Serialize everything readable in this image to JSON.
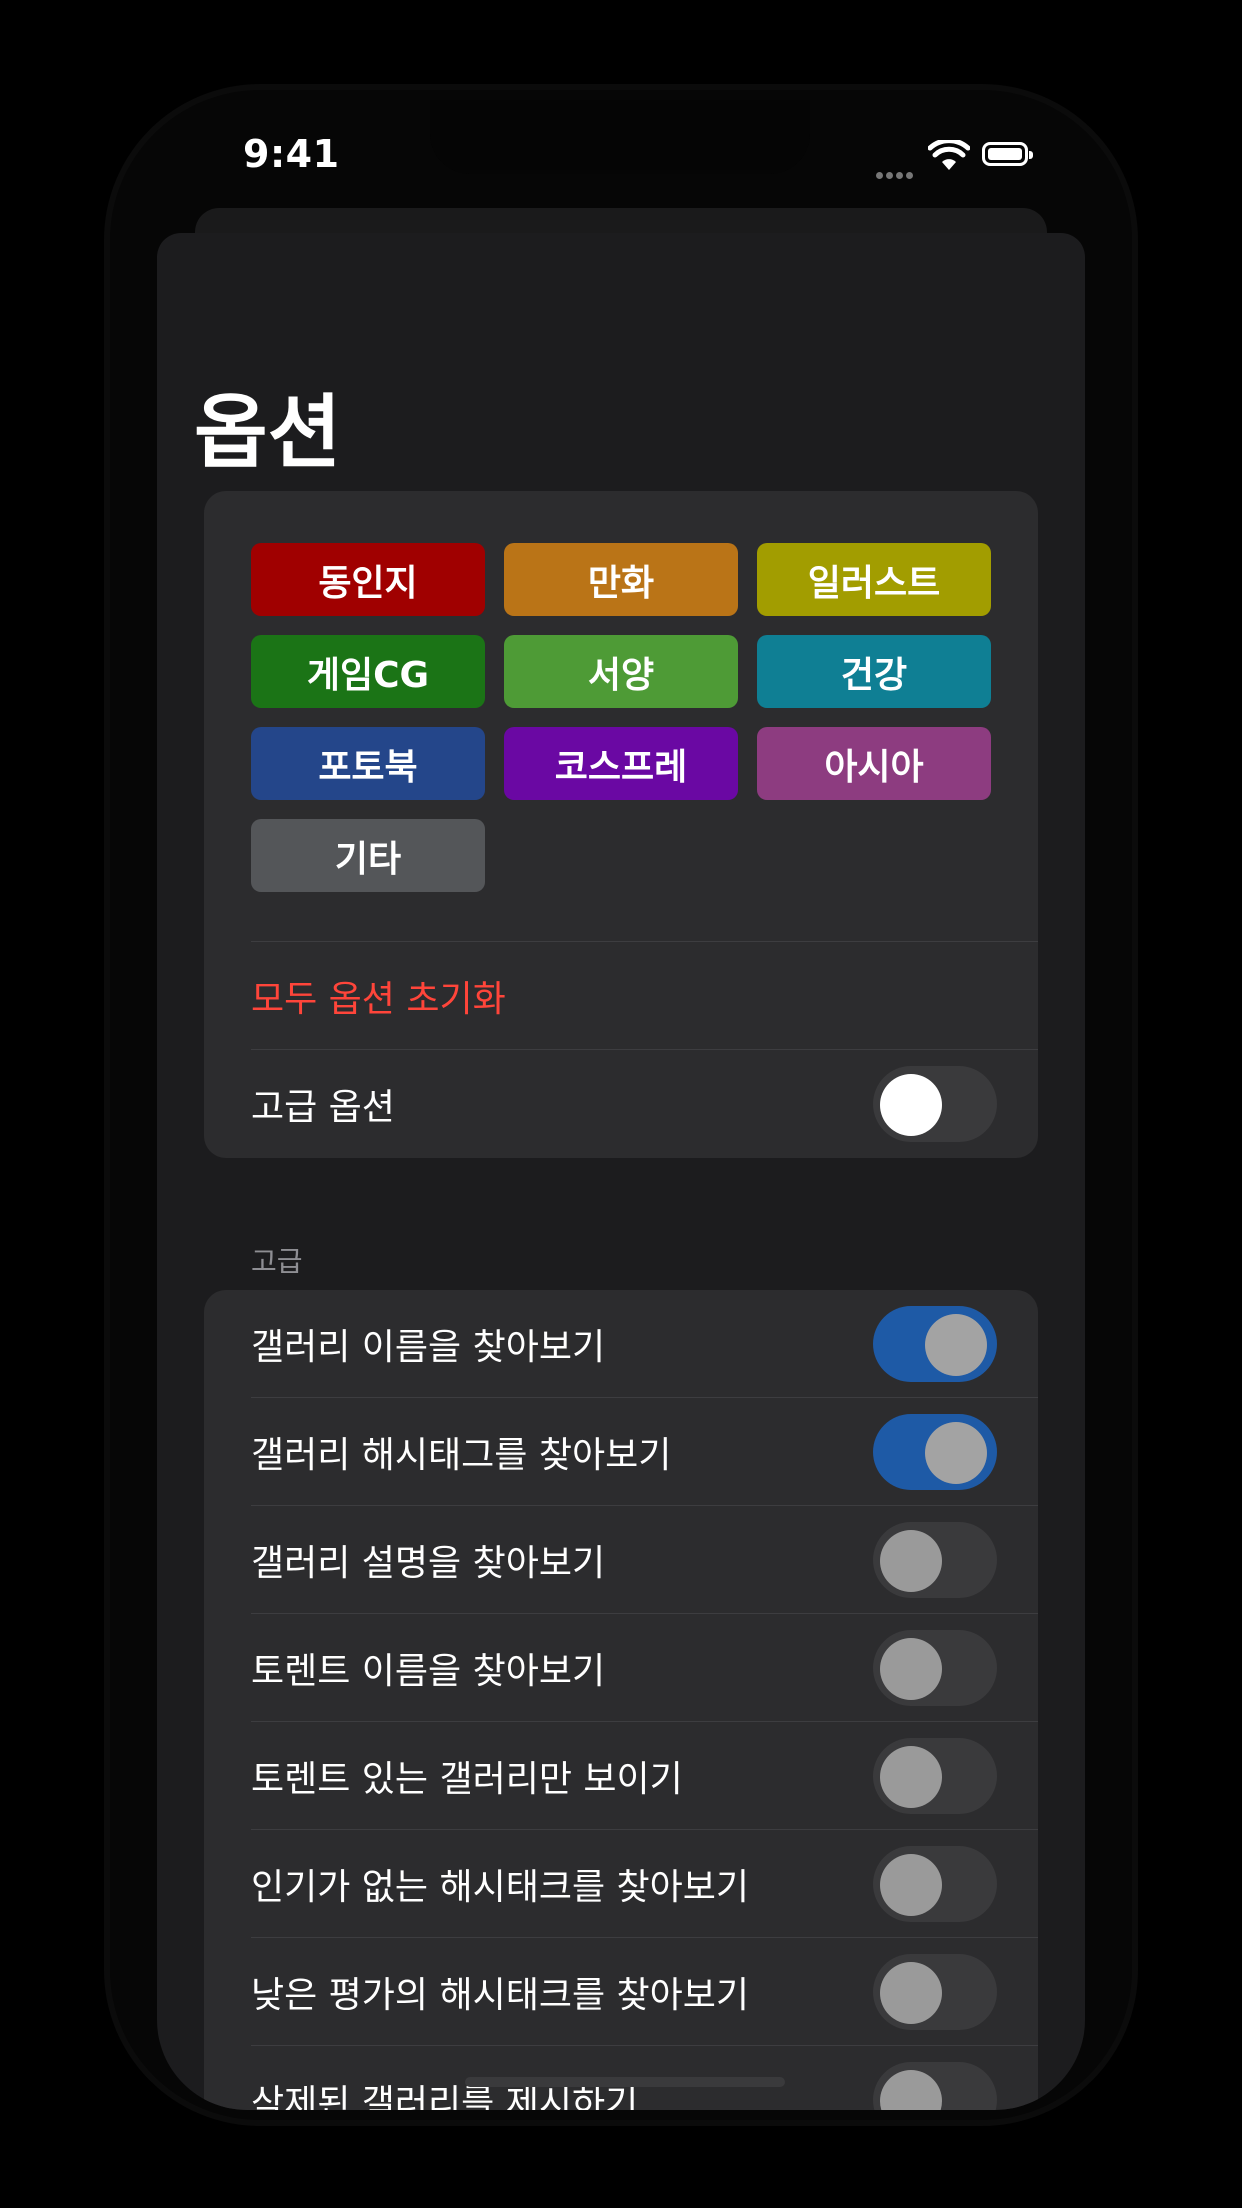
{
  "status_bar": {
    "time": "9:41"
  },
  "page": {
    "title": "옵션"
  },
  "categories": [
    {
      "label": "동인지",
      "color": "#a00000"
    },
    {
      "label": "만화",
      "color": "#ba7417"
    },
    {
      "label": "일러스트",
      "color": "#a29d00"
    },
    {
      "label": "게임CG",
      "color": "#1b7416"
    },
    {
      "label": "서양",
      "color": "#4e9b36"
    },
    {
      "label": "건강",
      "color": "#0f7f94"
    },
    {
      "label": "포토북",
      "color": "#24468a"
    },
    {
      "label": "코스프레",
      "color": "#6a08a3"
    },
    {
      "label": "아시아",
      "color": "#8d3c80"
    },
    {
      "label": "기타",
      "color": "#545659"
    }
  ],
  "reset": {
    "label": "모두 옵션 초기화",
    "color": "#ff453a"
  },
  "advanced_toggle": {
    "label": "고급 옵션",
    "on": false
  },
  "advanced_section": {
    "header": "고급",
    "items": [
      {
        "label": "갤러리 이름을 찾아보기",
        "on": true
      },
      {
        "label": "갤러리 해시태그를 찾아보기",
        "on": true
      },
      {
        "label": "갤러리 설명을 찾아보기",
        "on": false
      },
      {
        "label": "토렌트 이름을 찾아보기",
        "on": false
      },
      {
        "label": "토렌트 있는 갤러리만 보이기",
        "on": false
      },
      {
        "label": "인기가 없는 해시태크를 찾아보기",
        "on": false
      },
      {
        "label": "낮은 평가의 해시태크를 찾아보기",
        "on": false
      },
      {
        "label": "삭제된 갤러리를 제시하기",
        "on": false
      }
    ]
  },
  "colors": {
    "background": "#000000",
    "sheet": "#1c1c1e",
    "card": "#2c2c2e",
    "toggle_on": "#1e5aa6"
  }
}
